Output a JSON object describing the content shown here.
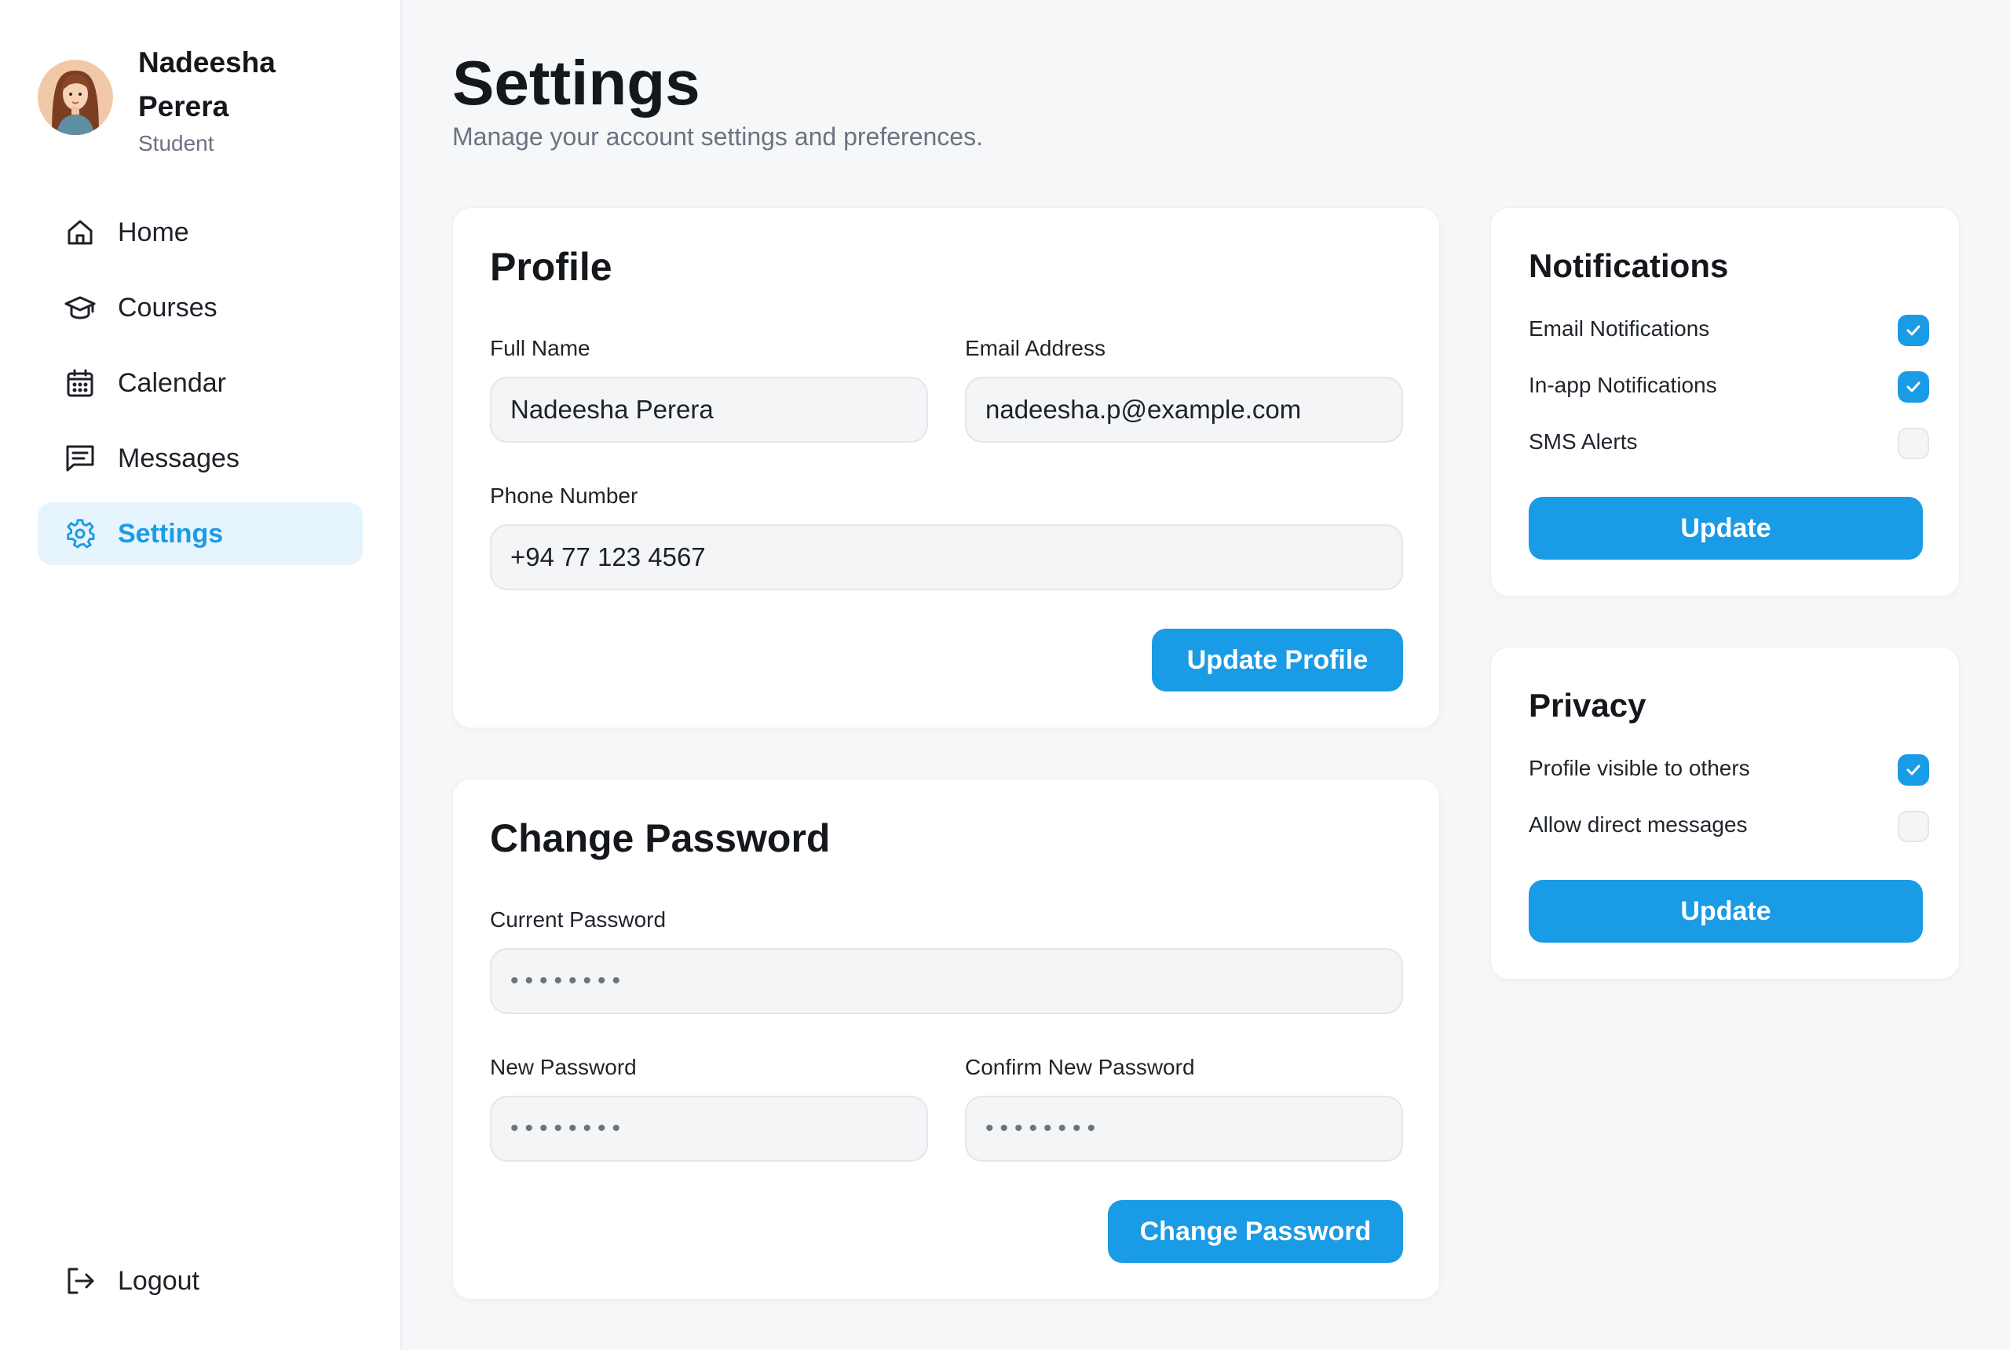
{
  "user": {
    "name": "Nadeesha Perera",
    "role": "Student"
  },
  "nav": {
    "items": [
      {
        "label": "Home",
        "icon": "home-icon"
      },
      {
        "label": "Courses",
        "icon": "graduation-cap-icon"
      },
      {
        "label": "Calendar",
        "icon": "calendar-icon"
      },
      {
        "label": "Messages",
        "icon": "message-icon"
      },
      {
        "label": "Settings",
        "icon": "gear-icon",
        "active": true
      }
    ],
    "logout": {
      "label": "Logout",
      "icon": "logout-icon"
    }
  },
  "page": {
    "title": "Settings",
    "subtitle": "Manage your account settings and preferences."
  },
  "profile": {
    "title": "Profile",
    "full_name_label": "Full Name",
    "full_name_value": "Nadeesha Perera",
    "email_label": "Email Address",
    "email_value": "nadeesha.p@example.com",
    "phone_label": "Phone Number",
    "phone_value": "+94 77 123 4567",
    "button": "Update Profile"
  },
  "password": {
    "title": "Change Password",
    "current_label": "Current Password",
    "current_value": "••••••••",
    "new_label": "New Password",
    "new_value": "••••••••",
    "confirm_label": "Confirm New Password",
    "confirm_value": "••••••••",
    "button": "Change Password"
  },
  "notifications": {
    "title": "Notifications",
    "options": [
      {
        "label": "Email Notifications",
        "checked": true
      },
      {
        "label": "In-app Notifications",
        "checked": true
      },
      {
        "label": "SMS Alerts",
        "checked": false
      }
    ],
    "button": "Update"
  },
  "privacy": {
    "title": "Privacy",
    "options": [
      {
        "label": "Profile visible to others",
        "checked": true
      },
      {
        "label": "Allow direct messages",
        "checked": false
      }
    ],
    "button": "Update"
  },
  "colors": {
    "accent": "#1a9be6",
    "accent_light": "#e6f4fd",
    "background": "#f6f7f9",
    "card": "#ffffff",
    "text": "#14171c",
    "muted": "#6b7280"
  }
}
